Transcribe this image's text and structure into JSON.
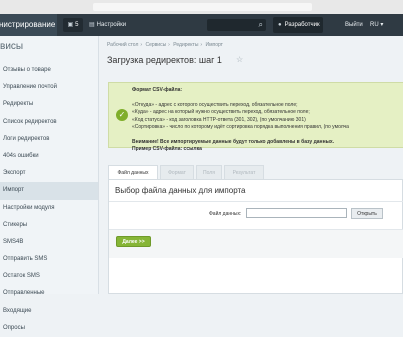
{
  "topbar": {
    "admin_title": "нистрирование",
    "notifications_count": "5",
    "settings_label": "Настройки",
    "user_label": "Разработчик",
    "logout_label": "Выйти",
    "lang_label": "RU"
  },
  "sidebar": {
    "heading": "висы",
    "items": [
      {
        "label": "Отзывы о товаре"
      },
      {
        "label": "Управление почтой"
      },
      {
        "label": "Редиректы"
      },
      {
        "label": "Список редиректов"
      },
      {
        "label": "Логи редиректов"
      },
      {
        "label": "404s ошибки"
      },
      {
        "label": "Экспорт"
      },
      {
        "label": "Импорт"
      },
      {
        "label": "Настройки модуля"
      },
      {
        "label": "Стикеры"
      },
      {
        "label": "SMS4B"
      },
      {
        "label": "Отправить SMS"
      },
      {
        "label": "Остаток SMS"
      },
      {
        "label": "Отправленные"
      },
      {
        "label": "Входящие"
      },
      {
        "label": "Опросы"
      }
    ],
    "active_index": 7
  },
  "breadcrumb": [
    "Рабочий стол",
    "Сервисы",
    "Редиректы",
    "Импорт"
  ],
  "page_title": "Загрузка редиректов: шаг 1",
  "info": {
    "lines": [
      "Формат CSV-файла:",
      "",
      "«Откуда» - адрес с которого осуществить переход, обязательное поле;",
      "«Куда» - адрес на который нужно осуществить переход, обязательное поле;",
      "«Код статуса» - код заголовка HTTP-ответа (301, 302), (по умолчанию 301)",
      "«Сортировка» - число по которому идёт сортировка порядка выполнения правил, (по умолча",
      "",
      "Внимание! Все импортируемые данные будут только добавлены в базу данных.",
      "Пример CSV-файла: ссылка"
    ]
  },
  "tabs": [
    {
      "label": "Файл данных"
    },
    {
      "label": "Формат"
    },
    {
      "label": "Поля"
    },
    {
      "label": "Результат"
    }
  ],
  "panel": {
    "title": "Выбор файла данных для импорта",
    "file_label": "Файл данных:",
    "file_value": "",
    "open_button": "Открыть",
    "next_button": "Далее >>"
  },
  "colors": {
    "topbar": "#2f3a43",
    "info_background": "#e5f0c4",
    "accent_green": "#86b536"
  }
}
